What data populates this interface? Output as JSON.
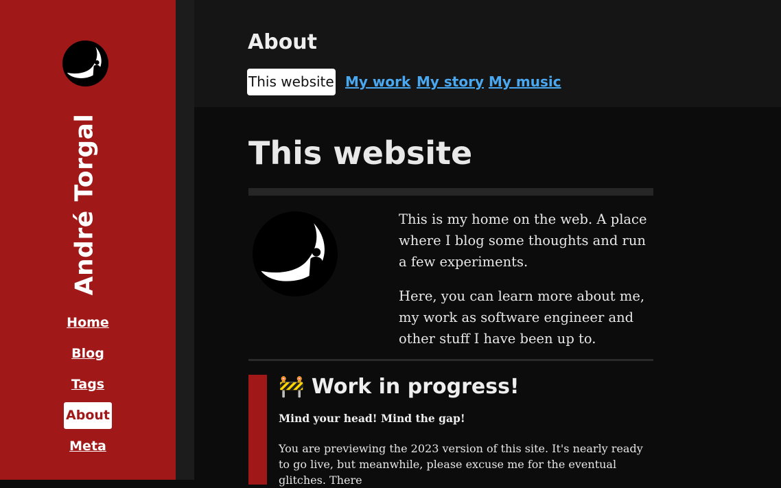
{
  "site": {
    "name": "André Torgal"
  },
  "sidebar": {
    "items": [
      {
        "label": "Home",
        "active": false
      },
      {
        "label": "Blog",
        "active": false
      },
      {
        "label": "Tags",
        "active": false
      },
      {
        "label": "About",
        "active": true
      },
      {
        "label": "Meta",
        "active": false
      }
    ]
  },
  "header": {
    "title": "About",
    "tabs": [
      {
        "label": "This website",
        "active": true
      },
      {
        "label": "My work",
        "active": false
      },
      {
        "label": "My story",
        "active": false
      },
      {
        "label": "My music",
        "active": false
      }
    ]
  },
  "main": {
    "title": "This website",
    "intro": [
      "This is my home on the web. A place where I blog some thoughts and run a few experiments.",
      "Here, you can learn more about me, my work as software engineer and other stuff I have been up to."
    ],
    "wip": {
      "icon": "🚧",
      "heading": "Work in progress!",
      "subheading": "Mind your head! Mind the gap!",
      "body": "You are previewing the 2023 version of this site. It's nearly ready to go live, but meanwhile, please excuse me for the eventual glitches. There"
    }
  },
  "colors": {
    "accent": "#a01818",
    "link": "#4aa8f0",
    "background": "#0c0c0c",
    "header_background": "#151515"
  },
  "icons": {
    "logo": "moon-silhouette-logo-icon",
    "wip": "construction-sign-icon"
  }
}
